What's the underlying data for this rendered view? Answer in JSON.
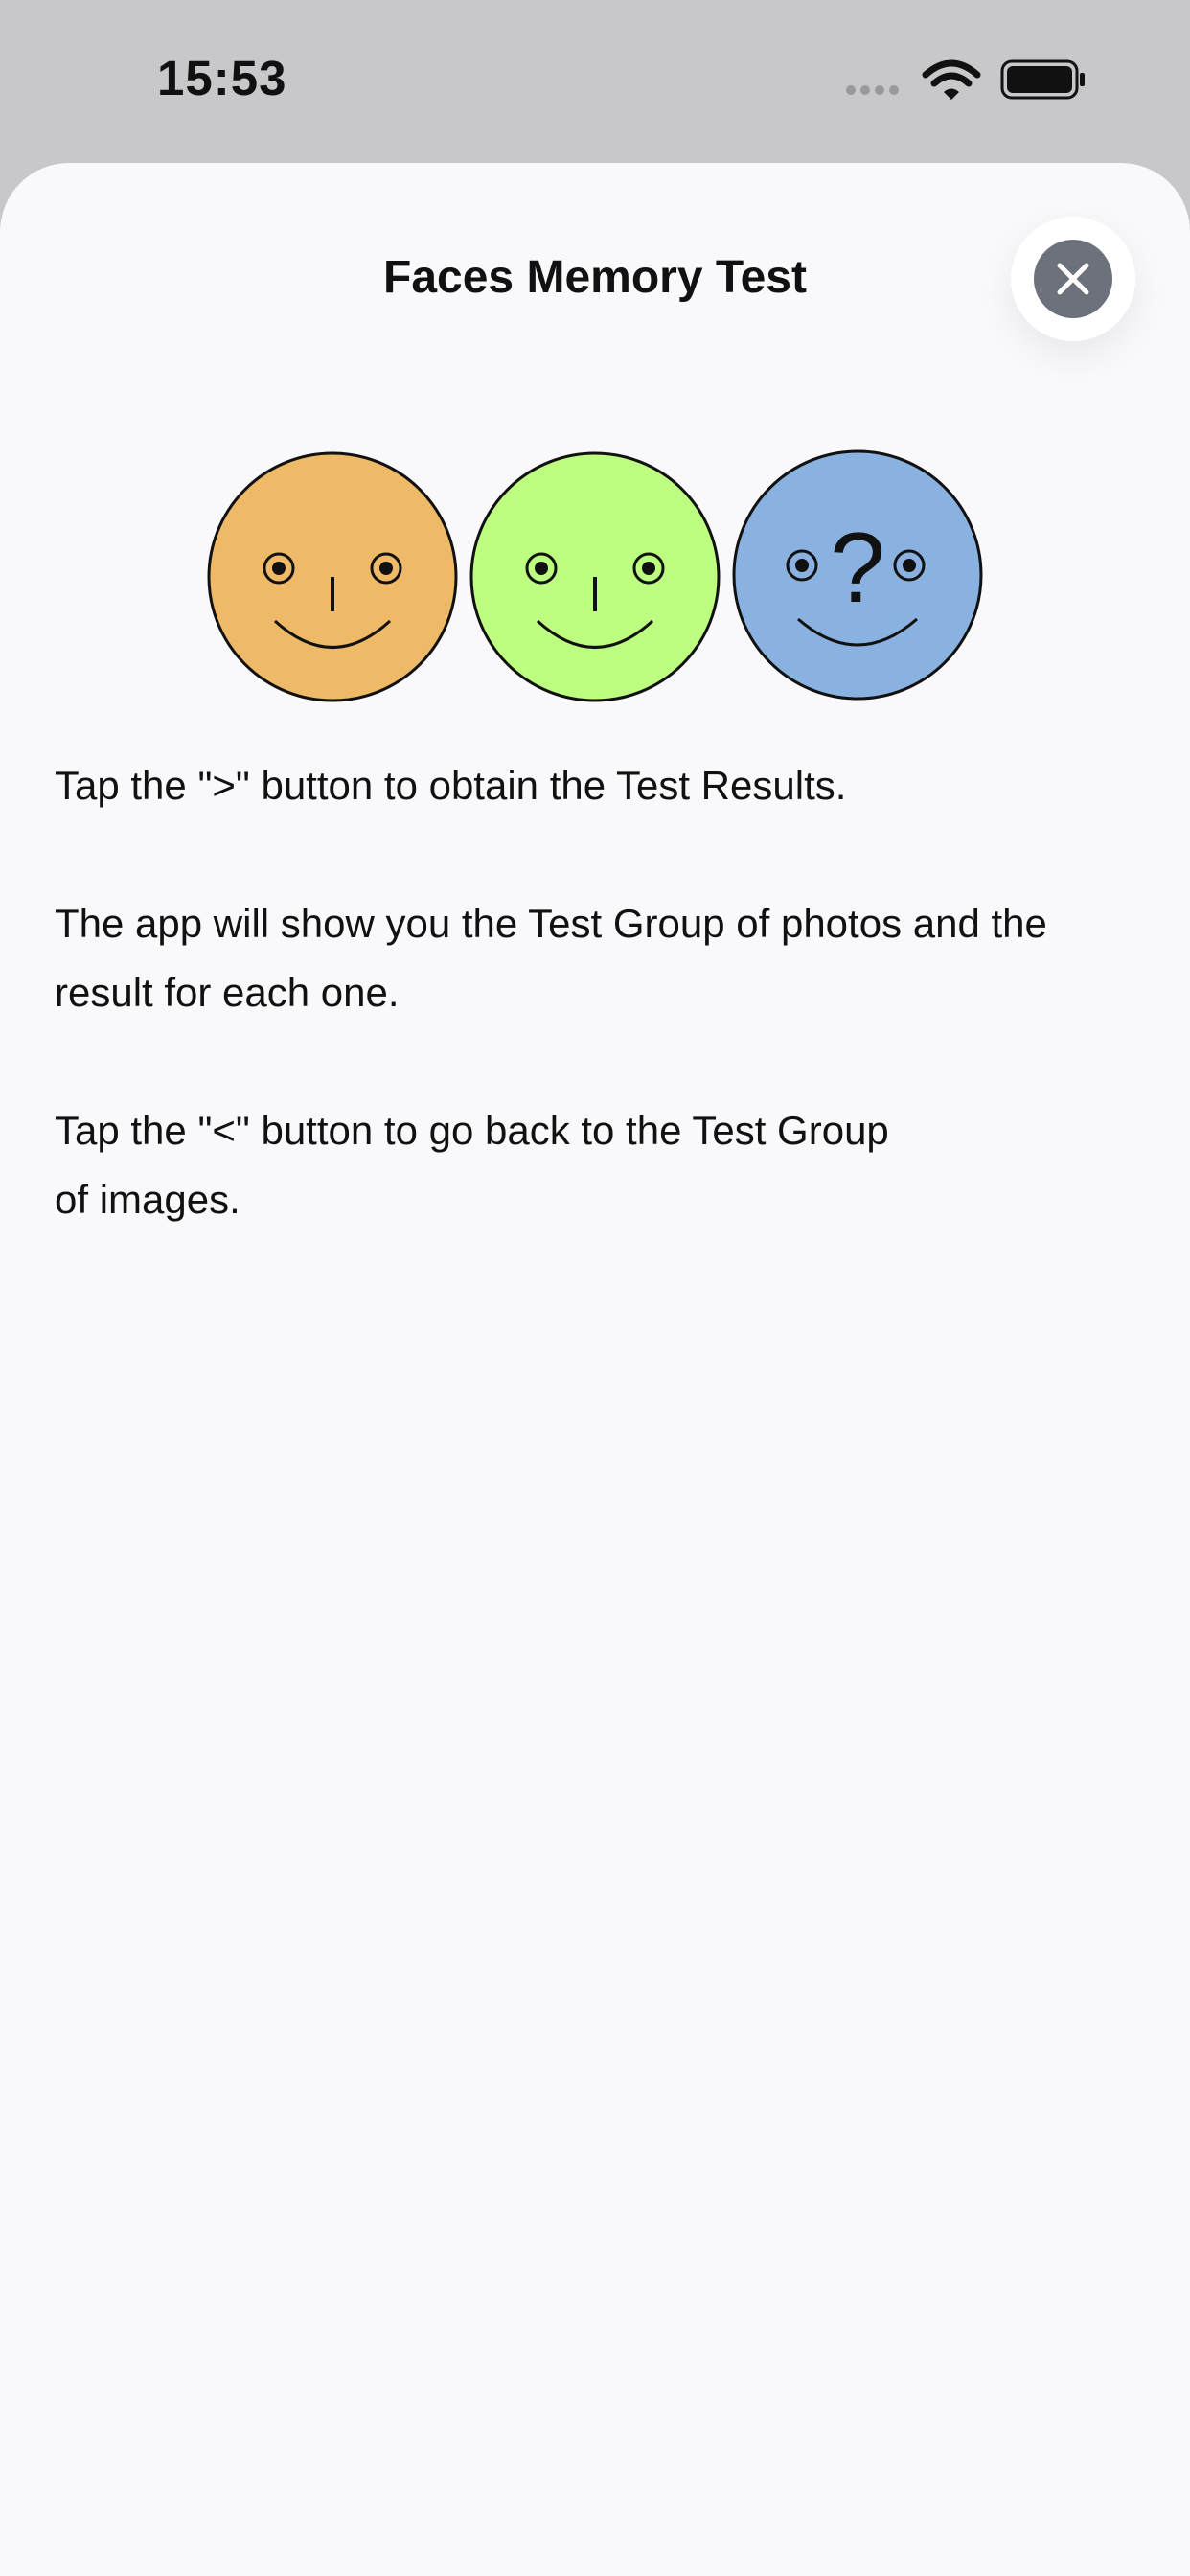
{
  "status_bar": {
    "time": "15:53",
    "icons": [
      "cellular-dots-icon",
      "wifi-icon",
      "battery-icon"
    ]
  },
  "sheet": {
    "title": "Faces Memory Test",
    "close_icon": "close-icon"
  },
  "faces": {
    "items": [
      {
        "color": "#efba67",
        "center_glyph": "",
        "icon": "smiley-face-orange"
      },
      {
        "color": "#bdfd7f",
        "center_glyph": "",
        "icon": "smiley-face-green"
      },
      {
        "color": "#8ab2e0",
        "center_glyph": "?",
        "icon": "smiley-face-question-blue"
      }
    ]
  },
  "instructions": {
    "paragraph_1": "Tap the \">\" button to obtain the Test Results.",
    "paragraph_2": "The app will show you the Test Group of photos and the result for each one.",
    "paragraph_3_line_1": "Tap the \"<\" button to go back to the Test Group",
    "paragraph_3_line_2": "of images."
  },
  "colors": {
    "sheet_background": "#f9f9fb",
    "status_background": "#c8c8ca",
    "close_button": "#6d717c"
  }
}
